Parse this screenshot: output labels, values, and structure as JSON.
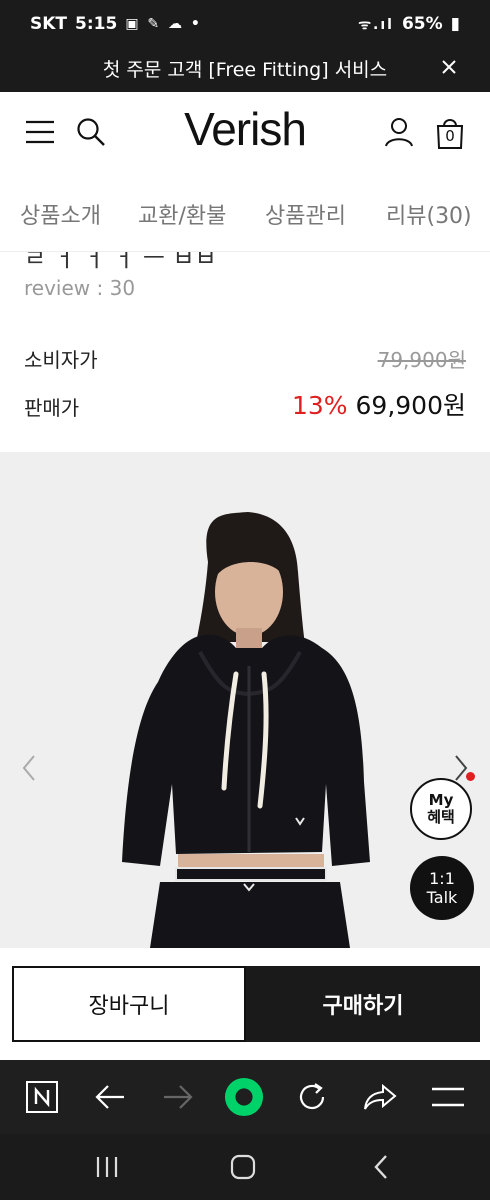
{
  "status_bar": {
    "carrier": "SKT",
    "time": "5:15",
    "battery": "65%",
    "left_icons": "▣ ✎ ☁ •",
    "right_icons": "ᯤ.ıl"
  },
  "promo_banner": {
    "text": "첫 주문 고객 [Free Fitting] 서비스",
    "close_icon": "close-icon"
  },
  "header": {
    "logo": "Verish",
    "cart_count": "0",
    "icons": [
      "hamburger-icon",
      "search-icon",
      "account-icon",
      "cart-icon"
    ]
  },
  "tabs": [
    "상품소개",
    "교환/환불",
    "상품관리",
    "리뷰(30)"
  ],
  "product": {
    "title_fragment": "ㄹ ㅓ ㅓ ㅓ  ㅡ  ㅂㅂ",
    "review": "review : 30",
    "consumer_price_label": "소비자가",
    "consumer_price": "79,900원",
    "sale_price_label": "판매가",
    "discount": "13%",
    "sale_price": "69,900원"
  },
  "gallery": {
    "my_benefit_line1": "My",
    "my_benefit_line2": "혜택",
    "talk_line1": "1:1",
    "talk_line2": "Talk"
  },
  "actions": {
    "cart": "장바구니",
    "buy": "구매하기"
  },
  "browser_bar": {
    "icons": [
      "naver-icon",
      "back-arrow-icon",
      "forward-arrow-icon",
      "green-dot-icon",
      "refresh-icon",
      "share-icon",
      "menu-icon"
    ]
  },
  "nav_bar": {
    "icons": [
      "recent-apps-icon",
      "home-icon",
      "back-icon"
    ]
  },
  "colors": {
    "accent_red": "#e02020",
    "dark": "#1b1b1b",
    "green": "#00d26a"
  }
}
